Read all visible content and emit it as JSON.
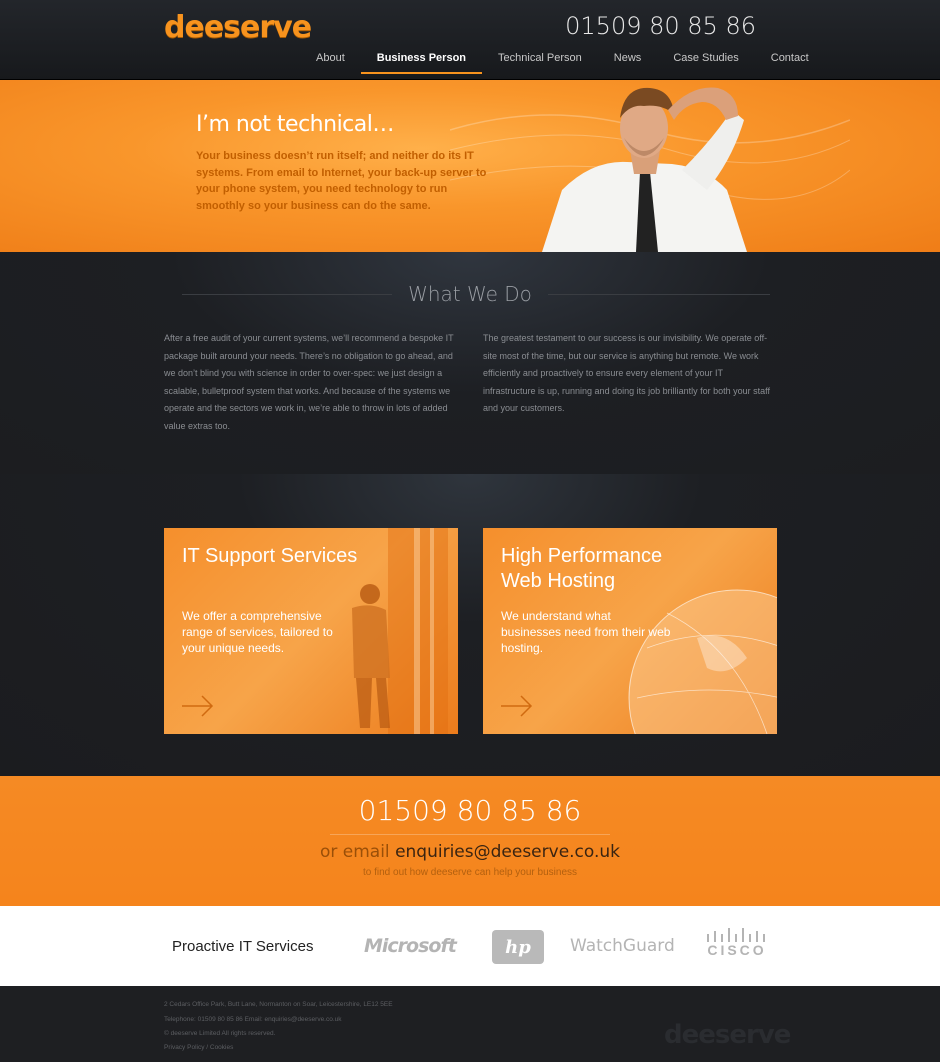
{
  "header": {
    "logo": "deeserve",
    "phone": "01509 80 85 86",
    "nav": [
      "About",
      "Business Person",
      "Technical Person",
      "News",
      "Case Studies",
      "Contact"
    ],
    "active_nav": "Business Person"
  },
  "hero": {
    "title": "I’m not technical…",
    "body": "Your business doesn’t run itself; and neither do its IT systems. From email to Internet, your back-up server to your phone system, you need technology to run smoothly so your business can do the same."
  },
  "what_we_do": {
    "title": "What We Do",
    "col1": "After a free audit of your current systems, we’ll recommend a bespoke IT package built around your needs. There’s no obligation to go ahead, and we don’t blind you with science in order to over-spec: we just design a scalable, bulletproof system that works. And because of the systems we operate and the sectors we work in, we’re able to throw in lots of added value extras too.",
    "col2": "The greatest testament to our success is our invisibility. We operate off-site most of the time, but our service is anything but remote. We work efficiently and proactively to ensure every element of your IT infrastructure is up, running and doing its job brilliantly for both your staff and your customers."
  },
  "services": [
    {
      "title": "IT Support Services",
      "body": "We offer a comprehensive range of services, tailored to your unique needs."
    },
    {
      "title": "High Performance Web Hosting",
      "body": "We understand what businesses need from their web hosting."
    }
  ],
  "cta": {
    "phone": "01509 80 85 86",
    "email_prefix": "or email",
    "email": "enquiries@deeserve.co.uk",
    "sub": "to find out how deeserve can help your business"
  },
  "partners": {
    "label": "Proactive IT Services",
    "logos": [
      "Microsoft",
      "hp",
      "WatchGuard",
      "CISCO"
    ]
  },
  "footer": {
    "address": "2 Cedars Office Park, Butt Lane, Normanton on Soar, Leicestershire, LE12 5EE",
    "contact": "Telephone: 01509 80 85 86 Email: enquiries@deeserve.co.uk",
    "copyright": "© deeserve Limited All rights reserved.",
    "links": "Privacy Policy / Cookies",
    "logo": "deeserve"
  },
  "colors": {
    "accent": "#f7931e",
    "dark": "#1c1d20"
  }
}
